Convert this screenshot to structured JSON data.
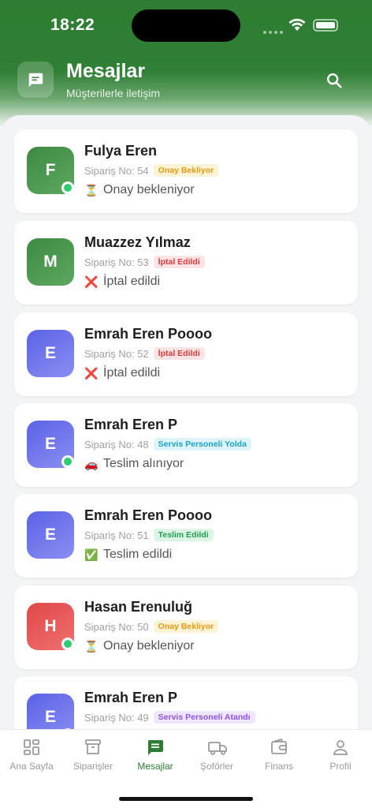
{
  "status_bar": {
    "time": "18:22"
  },
  "header": {
    "title": "Mesajlar",
    "subtitle": "Müşterilerle iletişim",
    "title_icon": "chat-bubble-icon",
    "search_icon": "search-icon"
  },
  "colors": {
    "primary": "#2e7d32",
    "online": "#2ecc71"
  },
  "conversations": [
    {
      "initial": "F",
      "name": "Fulya Eren",
      "order": "Sipariş No: 54",
      "badge": "Onay Bekliyor",
      "badge_type": "pending",
      "status_icon": "⏳",
      "status": "Onay bekleniyor",
      "avatar": "green",
      "online": true
    },
    {
      "initial": "M",
      "name": "Muazzez Yılmaz",
      "order": "Sipariş No: 53",
      "badge": "İptal Edildi",
      "badge_type": "cancelled",
      "status_icon": "❌",
      "status": "İptal edildi",
      "avatar": "green",
      "online": false
    },
    {
      "initial": "E",
      "name": "Emrah Eren Poooo",
      "order": "Sipariş No: 52",
      "badge": "İptal Edildi",
      "badge_type": "cancelled",
      "status_icon": "❌",
      "status": "İptal edildi",
      "avatar": "blue",
      "online": false
    },
    {
      "initial": "E",
      "name": "Emrah Eren P",
      "order": "Sipariş No: 48",
      "badge": "Servis Personeli Yolda",
      "badge_type": "onway",
      "status_icon": "🚗",
      "status": "Teslim alınıyor",
      "avatar": "blue",
      "online": true
    },
    {
      "initial": "E",
      "name": "Emrah Eren Poooo",
      "order": "Sipariş No: 51",
      "badge": "Teslim Edildi",
      "badge_type": "delivered",
      "status_icon": "✅",
      "status": "Teslim edildi",
      "avatar": "blue",
      "online": false
    },
    {
      "initial": "H",
      "name": "Hasan Erenuluğ",
      "order": "Sipariş No: 50",
      "badge": "Onay Bekliyor",
      "badge_type": "pending",
      "status_icon": "⏳",
      "status": "Onay bekleniyor",
      "avatar": "red",
      "online": true
    },
    {
      "initial": "E",
      "name": "Emrah Eren P",
      "order": "Sipariş No: 49",
      "badge": "Servis Personeli Atandı",
      "badge_type": "assigned",
      "status_icon": "",
      "status": "",
      "avatar": "blue",
      "online": true
    }
  ],
  "badge_styles": {
    "pending": {
      "bg": "#fff3d6",
      "fg": "#e39a13"
    },
    "cancelled": {
      "bg": "#fde3e3",
      "fg": "#d63b3b"
    },
    "onway": {
      "bg": "#ddf4fb",
      "fg": "#1aa2c9"
    },
    "delivered": {
      "bg": "#dcf6e6",
      "fg": "#1f9e52"
    },
    "assigned": {
      "bg": "#efe6fd",
      "fg": "#8b55e0"
    }
  },
  "tabs": [
    {
      "label": "Ana Sayfa",
      "icon": "dashboard-icon",
      "active": false
    },
    {
      "label": "Siparişler",
      "icon": "archive-box-icon",
      "active": false
    },
    {
      "label": "Mesajlar",
      "icon": "chat-bubble-icon",
      "active": true
    },
    {
      "label": "Şoförler",
      "icon": "truck-icon",
      "active": false
    },
    {
      "label": "Finans",
      "icon": "wallet-icon",
      "active": false
    },
    {
      "label": "Profil",
      "icon": "person-icon",
      "active": false
    }
  ]
}
